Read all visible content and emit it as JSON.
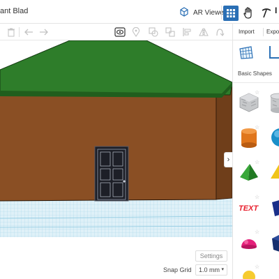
{
  "app": {
    "title": "ant Blad"
  },
  "header": {
    "ar_viewer_label": "AR Viewer",
    "user_partial": "I"
  },
  "panel": {
    "tabs": {
      "import": "Import",
      "export": "Expo"
    },
    "library_label": "Basic Shapes",
    "shapes": [
      {
        "name": "box-hole",
        "color": "#a9abae"
      },
      {
        "name": "cylinder-hole",
        "color": "#a9abae"
      },
      {
        "name": "cylinder",
        "color": "#e0761c"
      },
      {
        "name": "sphere",
        "color": "#1a8fc9"
      },
      {
        "name": "pyramid",
        "color": "#2e9a33"
      },
      {
        "name": "roof",
        "color": "#f0c419"
      },
      {
        "name": "text",
        "color": "#e8202e"
      },
      {
        "name": "box",
        "color": "#1a2f8a"
      },
      {
        "name": "half-sphere",
        "color": "#e4207a"
      },
      {
        "name": "polygon",
        "color": "#17306f"
      }
    ]
  },
  "viewport": {
    "settings_label": "Settings",
    "snap_grid_label": "Snap Grid",
    "snap_grid_value": "1.0 mm"
  },
  "colors": {
    "accent": "#2a6fb5",
    "roof": "#2e7d2a",
    "wall": "#8a4f24",
    "door": "#1d1f27",
    "grid": "#a9d7ea"
  }
}
